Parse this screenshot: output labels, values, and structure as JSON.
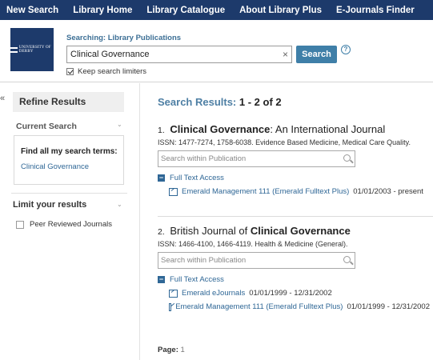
{
  "nav": {
    "items": [
      "New Search",
      "Library Home",
      "Library Catalogue",
      "About Library Plus",
      "E-Journals Finder"
    ]
  },
  "header": {
    "logo_text": "UNIVERSITY OF DERBY",
    "searching_label": "Searching: Library Publications",
    "search_value": "Clinical Governance",
    "search_button": "Search",
    "help": "?",
    "keep_limiters": "Keep search limiters",
    "keep_limiters_checked": true
  },
  "sidebar": {
    "collapse": "«",
    "refine_title": "Refine Results",
    "current_search_title": "Current Search",
    "find_all": "Find all my search terms:",
    "term": "Clinical Governance",
    "limit_title": "Limit your results",
    "limit_option": "Peer Reviewed Journals",
    "limit_option_checked": false
  },
  "results": {
    "label": "Search Results:",
    "count": "1 - 2 of 2",
    "within_placeholder": "Search within Publication",
    "full_text": "Full Text Access",
    "items": [
      {
        "num": "1.",
        "title_bold": "Clinical Governance",
        "title_rest": ": An International Journal",
        "issn": "ISSN: 1477-7274, 1758-6038. Evidence Based Medicine, Medical Care Quality.",
        "links": [
          {
            "name": "Emerald Management 111 (Emerald Fulltext Plus)",
            "dates": "01/01/2003 - present"
          }
        ]
      },
      {
        "num": "2.",
        "title_pre": "British Journal of ",
        "title_bold": "Clinical Governance",
        "issn": "ISSN: 1466-4100, 1466-4119. Health & Medicine (General).",
        "links": [
          {
            "name": "Emerald eJournals",
            "dates": "01/01/1999 - 12/31/2002"
          },
          {
            "name": "Emerald Management 111 (Emerald Fulltext Plus)",
            "dates": "01/01/1999 - 12/31/2002"
          }
        ]
      }
    ]
  },
  "pager": {
    "label": "Page:",
    "current": "1"
  },
  "colors": {
    "nav_bg": "#1d3a6b",
    "accent": "#3f7fa8",
    "link": "#2f6796",
    "results_title": "#4e7fa4"
  }
}
